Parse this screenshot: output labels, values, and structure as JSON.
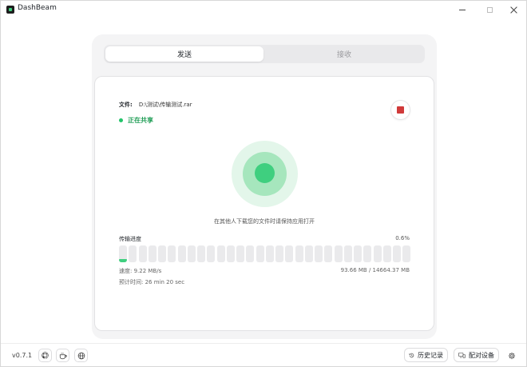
{
  "window": {
    "title": "DashBeam"
  },
  "tabs": [
    {
      "label": "发送",
      "active": true
    },
    {
      "label": "接收",
      "active": false
    }
  ],
  "transfer": {
    "file_label": "文件:",
    "file_path": "D:\\测试\\传输测试.rar",
    "status_text": "正在共享",
    "hint": "在其他人下载您的文件时请保持应用打开",
    "progress_label": "传输进度",
    "progress_percent": "0.6%",
    "progress_fraction": 0.006,
    "block_count": 30,
    "speed": "速度: 9.22 MB/s",
    "bytes": "93.66 MB / 14664.37 MB",
    "eta": "预计时间: 26 min 20 sec"
  },
  "footer": {
    "version": "v0.7.1",
    "history_label": "历史记录",
    "pair_label": "配对设备"
  },
  "icons": {
    "app": "dashbeam-logo-icon",
    "github": "github-icon",
    "coffee": "coffee-icon",
    "globe": "globe-icon",
    "history": "history-icon",
    "pair": "devices-icon",
    "settings": "gear-icon",
    "stop": "stop-icon"
  },
  "colors": {
    "accent": "#3fcf7f",
    "status_green": "#1f9d55",
    "stop_red": "#d03a3a"
  }
}
